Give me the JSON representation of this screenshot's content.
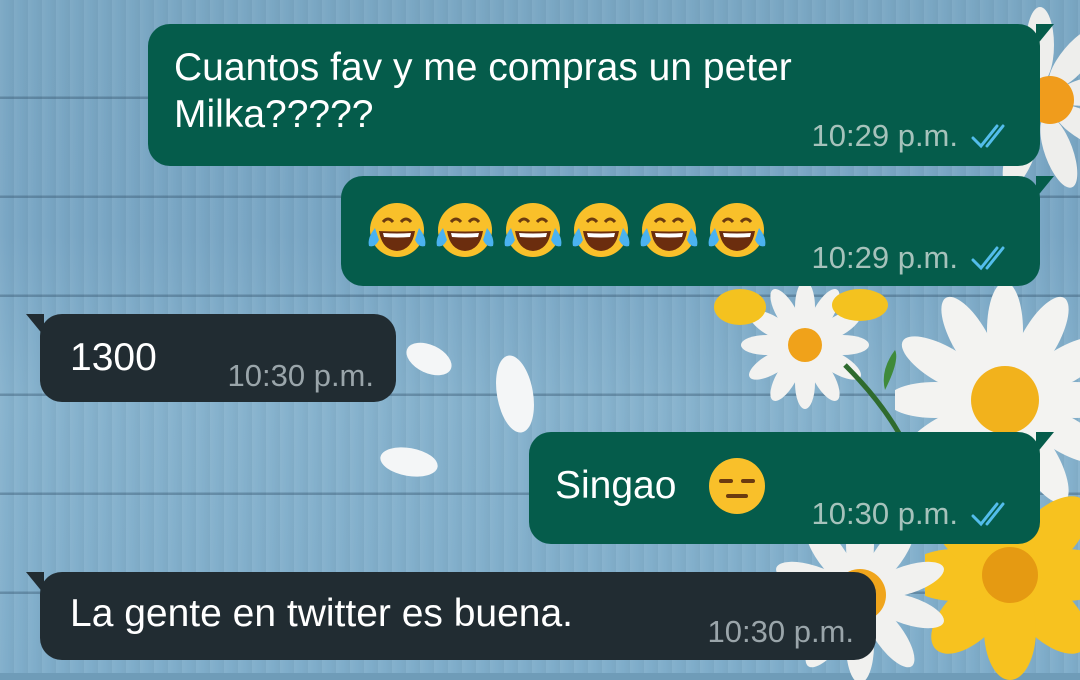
{
  "chat": {
    "messages": [
      {
        "direction": "outgoing",
        "text": "Cuantos fav y me compras un peter\nMilka?????",
        "time": "10:29 p.m.",
        "status": "read"
      },
      {
        "direction": "outgoing",
        "text": "",
        "emoji": [
          "face-with-tears-of-joy",
          "face-with-tears-of-joy",
          "face-with-tears-of-joy",
          "face-with-tears-of-joy",
          "face-with-tears-of-joy",
          "face-with-tears-of-joy"
        ],
        "time": "10:29 p.m.",
        "status": "read"
      },
      {
        "direction": "incoming",
        "text": "1300",
        "time": "10:30 p.m."
      },
      {
        "direction": "outgoing",
        "text": "Singao",
        "emoji": [
          "expressionless-face"
        ],
        "time": "10:30 p.m.",
        "status": "read"
      },
      {
        "direction": "incoming",
        "text": "La gente en twitter es buena.",
        "time": "10:30 p.m."
      }
    ]
  },
  "colors": {
    "outgoing_bubble": "#055c4b",
    "incoming_bubble": "#212c32",
    "read_ticks": "#53bdeb"
  },
  "icons": {
    "read_receipt": "double-check-icon"
  }
}
